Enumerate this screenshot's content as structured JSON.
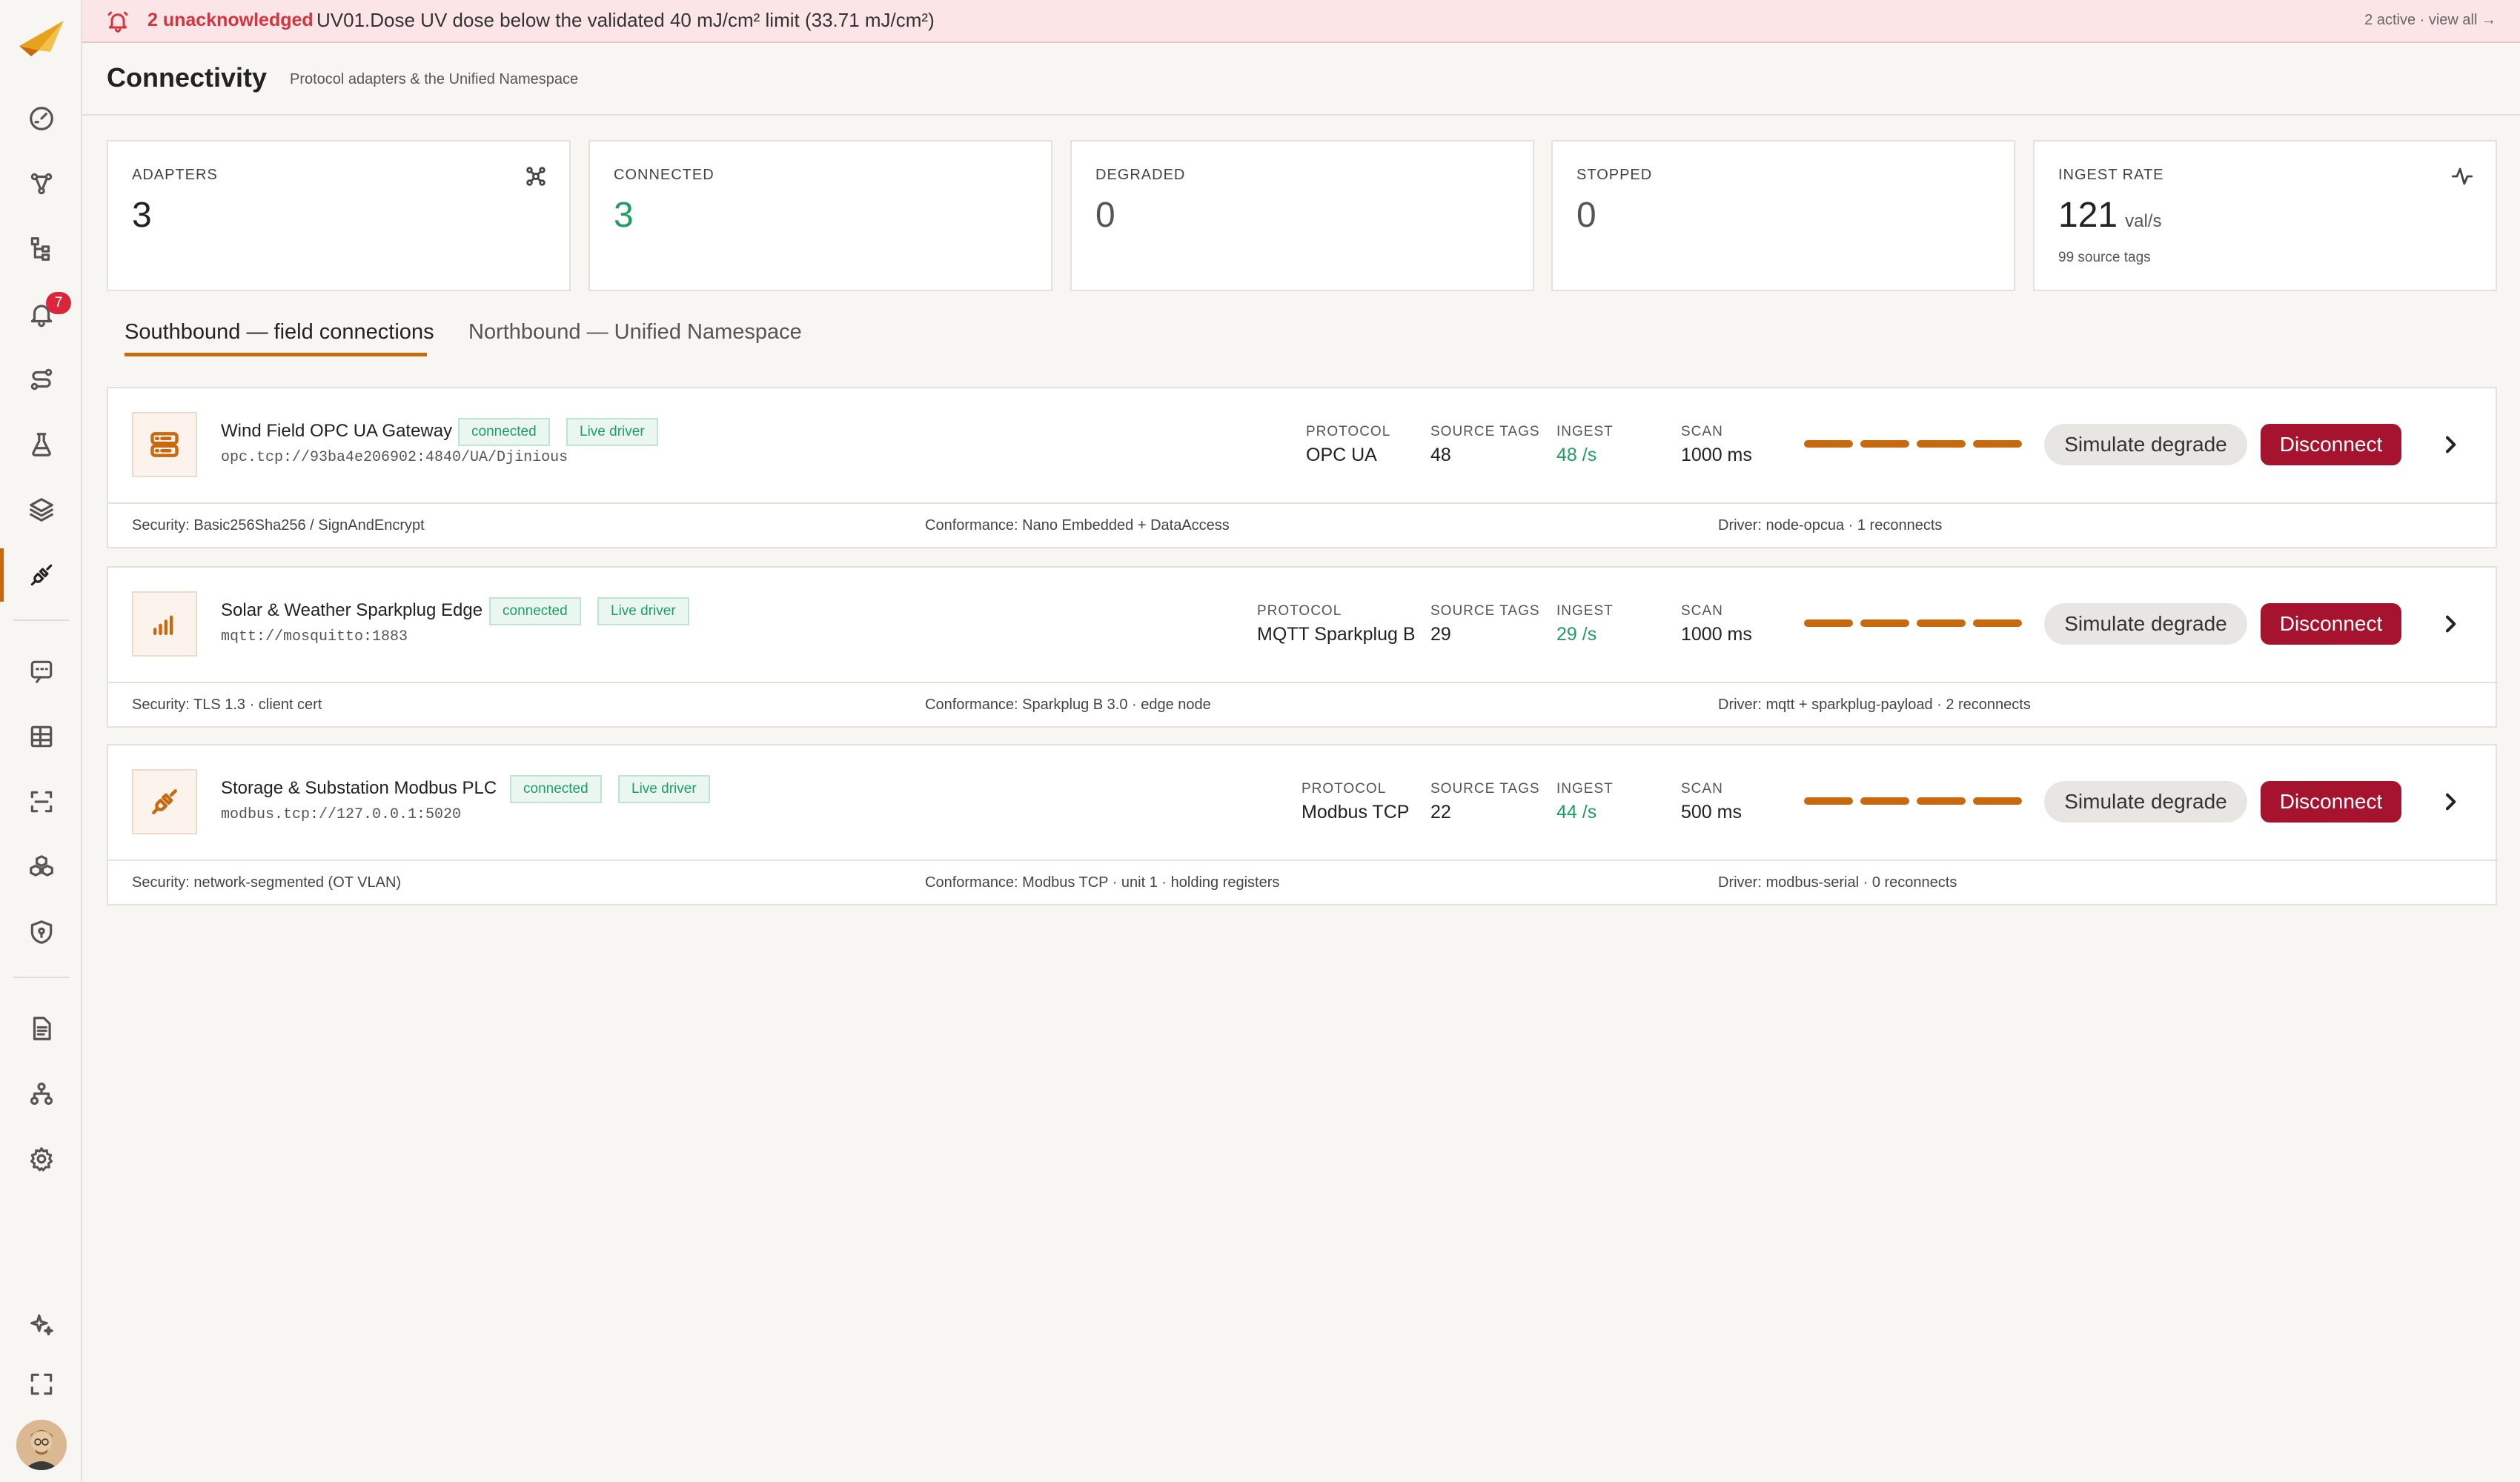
{
  "alert": {
    "count": "2 unacknowledged",
    "message": "UV01.Dose UV dose below the validated 40 mJ/cm² limit (33.71 mJ/cm²)",
    "link": "2 active · view all →"
  },
  "header": {
    "title": "Connectivity",
    "subtitle": "Protocol adapters & the Unified Namespace"
  },
  "sidebar": {
    "alarm_badge": "7"
  },
  "stats": [
    {
      "label": "ADAPTERS",
      "value": "3"
    },
    {
      "label": "CONNECTED",
      "value": "3"
    },
    {
      "label": "DEGRADED",
      "value": "0"
    },
    {
      "label": "STOPPED",
      "value": "0"
    },
    {
      "label": "INGEST RATE",
      "value": "121",
      "unit": "val/s",
      "sub": "99 source tags"
    }
  ],
  "tabs": [
    {
      "label": "Southbound — field connections"
    },
    {
      "label": "Northbound — Unified Namespace"
    }
  ],
  "metric_labels": {
    "protocol": "PROTOCOL",
    "tags": "SOURCE TAGS",
    "ingest": "INGEST",
    "scan": "SCAN"
  },
  "actions": {
    "simulate": "Simulate degrade",
    "disconnect": "Disconnect"
  },
  "adapters": [
    {
      "name": "Wind Field OPC UA Gateway",
      "status": "connected",
      "driver_badge": "Live driver",
      "url": "opc.tcp://93ba4e206902:4840/UA/Djinious",
      "protocol": "OPC UA",
      "tags": "48",
      "ingest": "48 /s",
      "scan": "1000 ms",
      "security": "Security: Basic256Sha256 / SignAndEncrypt",
      "conformance": "Conformance: Nano Embedded + DataAccess",
      "driver": "Driver: node-opcua · 1 reconnects"
    },
    {
      "name": "Solar & Weather Sparkplug Edge",
      "status": "connected",
      "driver_badge": "Live driver",
      "url": "mqtt://mosquitto:1883",
      "protocol": "MQTT Sparkplug B",
      "tags": "29",
      "ingest": "29 /s",
      "scan": "1000 ms",
      "security": "Security: TLS 1.3 · client cert",
      "conformance": "Conformance: Sparkplug B 3.0 · edge node",
      "driver": "Driver: mqtt + sparkplug-payload · 2 reconnects"
    },
    {
      "name": "Storage & Substation Modbus PLC",
      "status": "connected",
      "driver_badge": "Live driver",
      "url": "modbus.tcp://127.0.0.1:5020",
      "protocol": "Modbus TCP",
      "tags": "22",
      "ingest": "44 /s",
      "scan": "500 ms",
      "security": "Security: network-segmented (OT VLAN)",
      "conformance": "Conformance: Modbus TCP · unit 1 · holding registers",
      "driver": "Driver: modbus-serial · 0 reconnects"
    }
  ]
}
